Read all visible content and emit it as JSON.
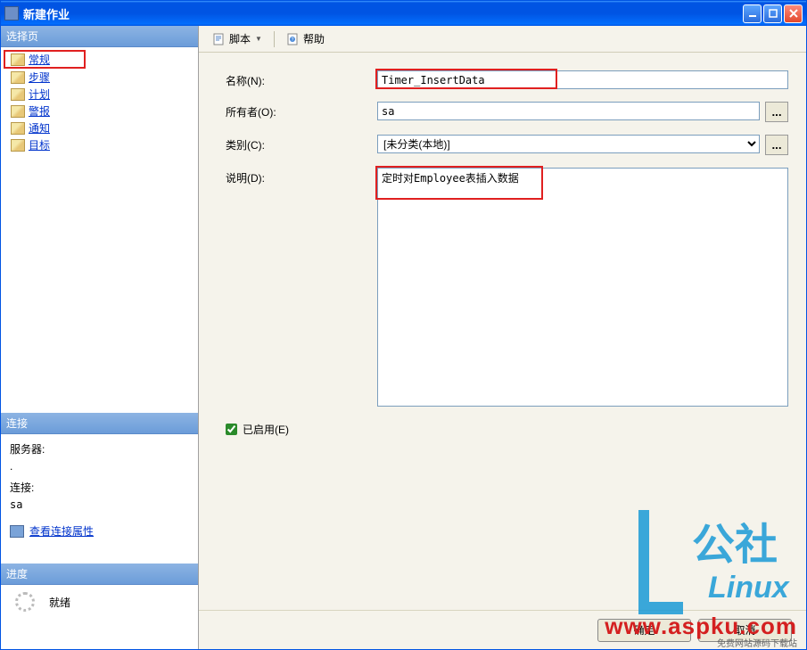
{
  "window": {
    "title": "新建作业"
  },
  "sidebar": {
    "select_page": "选择页",
    "items": [
      {
        "label": "常规"
      },
      {
        "label": "步骤"
      },
      {
        "label": "计划"
      },
      {
        "label": "警报"
      },
      {
        "label": "通知"
      },
      {
        "label": "目标"
      }
    ],
    "connection": {
      "header": "连接",
      "server_label": "服务器:",
      "server_value": ".",
      "conn_label": "连接:",
      "conn_value": "sa",
      "view_props": "查看连接属性"
    },
    "progress": {
      "header": "进度",
      "status": "就绪"
    }
  },
  "toolbar": {
    "script": "脚本",
    "help": "帮助"
  },
  "form": {
    "name_label": "名称(N):",
    "name_value": "Timer_InsertData",
    "owner_label": "所有者(O):",
    "owner_value": "sa",
    "category_label": "类别(C):",
    "category_value": "[未分类(本地)]",
    "description_label": "说明(D):",
    "description_value": "定时对Employee表插入数据",
    "enabled_label": "已启用(E)",
    "browse_text": "..."
  },
  "footer": {
    "ok": "确定",
    "cancel": "取消"
  },
  "watermark": {
    "brand": "公社",
    "sub": "Linux",
    "site": "www.aspku.com",
    "tag": "免费网站源码下载站"
  }
}
